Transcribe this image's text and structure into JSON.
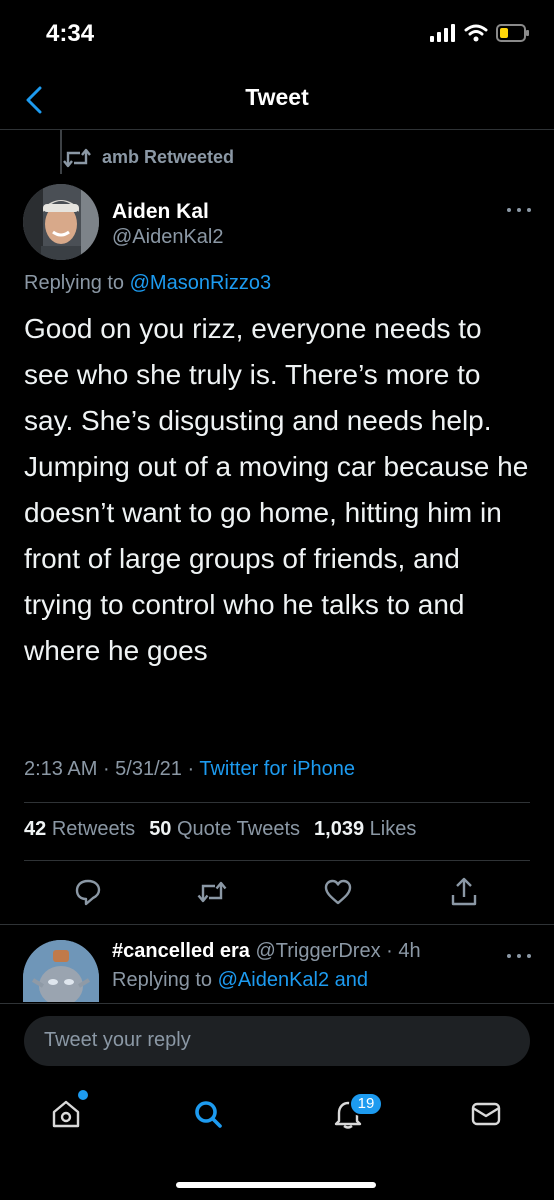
{
  "status_bar": {
    "time": "4:34",
    "icons": [
      "signal-icon",
      "wifi-icon",
      "battery-icon"
    ]
  },
  "nav": {
    "title": "Tweet",
    "back_icon": "chevron-left-icon"
  },
  "retweet": {
    "label": "amb Retweeted"
  },
  "tweet": {
    "author_name": "Aiden Kal",
    "author_handle": "@AidenKal2",
    "replying_prefix": "Replying to ",
    "replying_to": "@MasonRizzo3",
    "text": "Good on you rizz, everyone needs to see who she truly is. There’s more to say. She’s disgusting and needs help. Jumping out of a moving car because he doesn’t want to go home, hitting him in front of large groups of friends, and trying to control who he talks to and where he goes",
    "time": "2:13 AM",
    "sep1": " · ",
    "date": "5/31/21",
    "sep2": " · ",
    "source": "Twitter for iPhone",
    "retweets_count": "42",
    "retweets_label": "Retweets",
    "quotes_count": "50",
    "quotes_label": "Quote Tweets",
    "likes_count": "1,039",
    "likes_label": "Likes"
  },
  "reply_preview": {
    "name": "#cancelled era",
    "handle": "@TriggerDrex",
    "sep": " · ",
    "age": "4h",
    "replying_prefix": "Replying to ",
    "replying_to": "@AidenKal2 and"
  },
  "composer": {
    "placeholder": "Tweet your reply"
  },
  "tabbar": {
    "notifications_badge": "19"
  },
  "colors": {
    "accent": "#1d9bf0",
    "background": "#000000",
    "muted": "#8b98a5"
  }
}
